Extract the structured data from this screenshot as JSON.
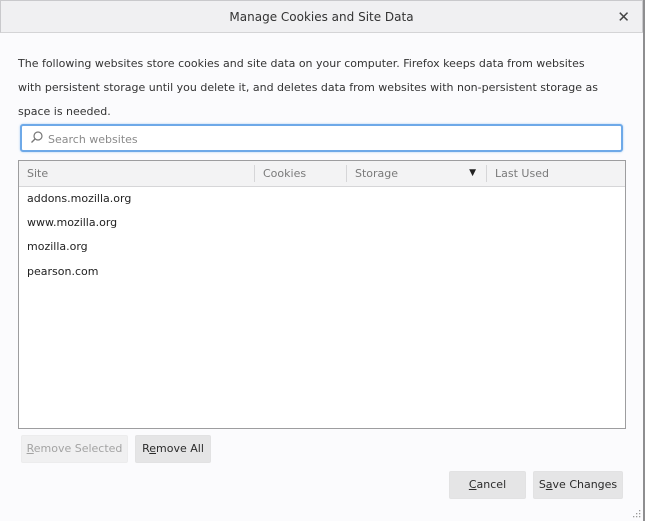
{
  "dialog": {
    "title": "Manage Cookies and Site Data",
    "close_icon": "close-icon",
    "description": "The following websites store cookies and site data on your computer. Firefox keeps data from websites with persistent storage until you delete it, and deletes data from websites with non-persistent storage as space is needed."
  },
  "search": {
    "icon": "search-icon",
    "placeholder": "Search websites",
    "value": ""
  },
  "table": {
    "columns": [
      {
        "label": "Site"
      },
      {
        "label": "Cookies"
      },
      {
        "label": "Storage",
        "sort_icon": "sort-descending-icon"
      },
      {
        "label": "Last Used"
      }
    ],
    "rows": [
      {
        "site": "addons.mozilla.org",
        "cookies": "",
        "storage": "",
        "last_used": ""
      },
      {
        "site": "www.mozilla.org",
        "cookies": "",
        "storage": "",
        "last_used": ""
      },
      {
        "site": "mozilla.org",
        "cookies": "",
        "storage": "",
        "last_used": ""
      },
      {
        "site": "pearson.com",
        "cookies": "",
        "storage": "",
        "last_used": ""
      }
    ]
  },
  "buttons": {
    "remove_selected": {
      "pre": "",
      "key": "R",
      "post": "emove Selected",
      "enabled": false
    },
    "remove_all": {
      "pre": "R",
      "key": "e",
      "post": "move All",
      "enabled": true
    },
    "cancel": {
      "pre": "",
      "key": "C",
      "post": "ancel",
      "enabled": true
    },
    "save_changes": {
      "pre": "S",
      "key": "a",
      "post": "ve Changes",
      "enabled": true
    }
  },
  "colors": {
    "focus_ring": "#6ea9e8",
    "button_bg": "#e5e5e6",
    "titlebar_bg": "#f0f0f2"
  }
}
